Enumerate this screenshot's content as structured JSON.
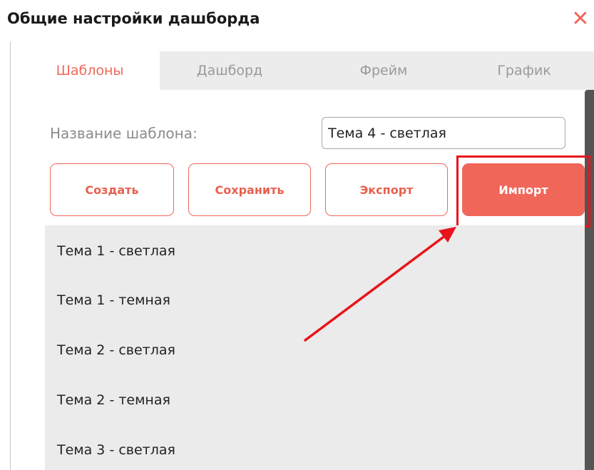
{
  "dialog": {
    "title": "Общие настройки дашборда",
    "close_symbol": "✕"
  },
  "tabs": [
    {
      "label": "Шаблоны",
      "active": true
    },
    {
      "label": "Дашборд",
      "active": false
    },
    {
      "label": "Фрейм",
      "active": false
    },
    {
      "label": "График",
      "active": false
    }
  ],
  "template_form": {
    "name_label": "Название шаблона:",
    "name_value": "Тема 4 - светлая"
  },
  "buttons": {
    "create": "Создать",
    "save": "Сохранить",
    "export": "Экспорт",
    "import": "Импорт"
  },
  "templates": [
    "Тема 1 - светлая",
    "Тема 1 - темная",
    "Тема 2 - светлая",
    "Тема 2 - темная",
    "Тема 3 - светлая"
  ],
  "colors": {
    "accent": "#f0675a",
    "annotation": "#e8141b"
  },
  "icons": {
    "close": "close-icon"
  }
}
